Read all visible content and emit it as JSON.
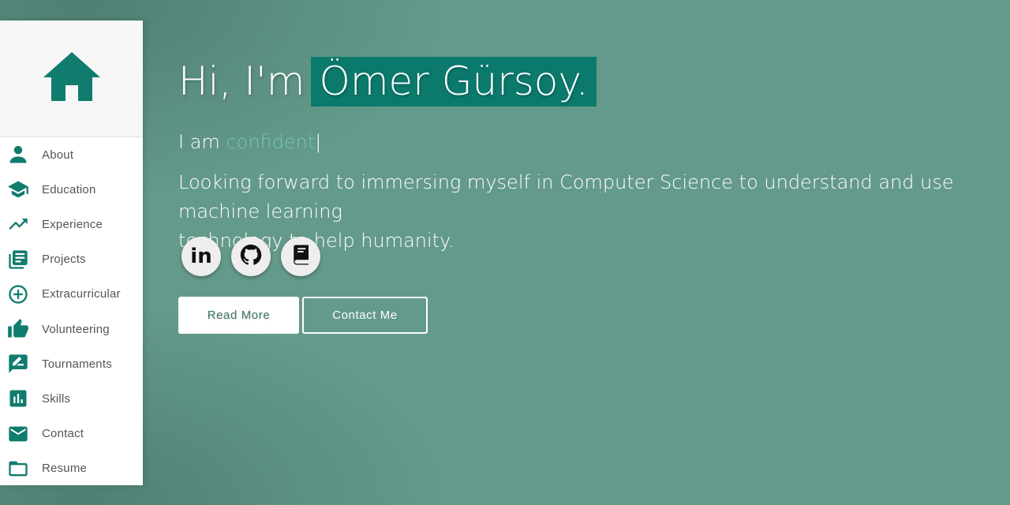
{
  "sidebar": {
    "home_icon": "home-icon",
    "items": [
      {
        "label": "About",
        "icon": "person-icon"
      },
      {
        "label": "Education",
        "icon": "graduation-cap-icon"
      },
      {
        "label": "Experience",
        "icon": "trending-up-icon"
      },
      {
        "label": "Projects",
        "icon": "article-list-icon"
      },
      {
        "label": "Extracurricular",
        "icon": "plus-circle-icon"
      },
      {
        "label": "Volunteering",
        "icon": "thumbs-up-icon"
      },
      {
        "label": "Tournaments",
        "icon": "rate-review-icon"
      },
      {
        "label": "Skills",
        "icon": "bar-chart-icon"
      },
      {
        "label": "Contact",
        "icon": "mail-icon"
      },
      {
        "label": "Resume",
        "icon": "folder-icon"
      }
    ]
  },
  "hero": {
    "greeting": "Hi, I'm",
    "name": "Ömer Gürsoy.",
    "typed_prefix": "I am",
    "typed_word": "confident",
    "cursor": "|",
    "description": "Looking forward to immersing myself in Computer Science to understand and use machine learning\ntechnology to help humanity.",
    "socials": [
      {
        "name": "linkedin",
        "icon": "linkedin-icon",
        "text": "in"
      },
      {
        "name": "github",
        "icon": "github-icon"
      },
      {
        "name": "book",
        "icon": "book-icon"
      }
    ],
    "read_more_label": "Read More",
    "contact_label": "Contact Me"
  },
  "colors": {
    "background": "#649a8b",
    "accent": "#0b7a6c",
    "typed_word": "#6fc9b1"
  }
}
